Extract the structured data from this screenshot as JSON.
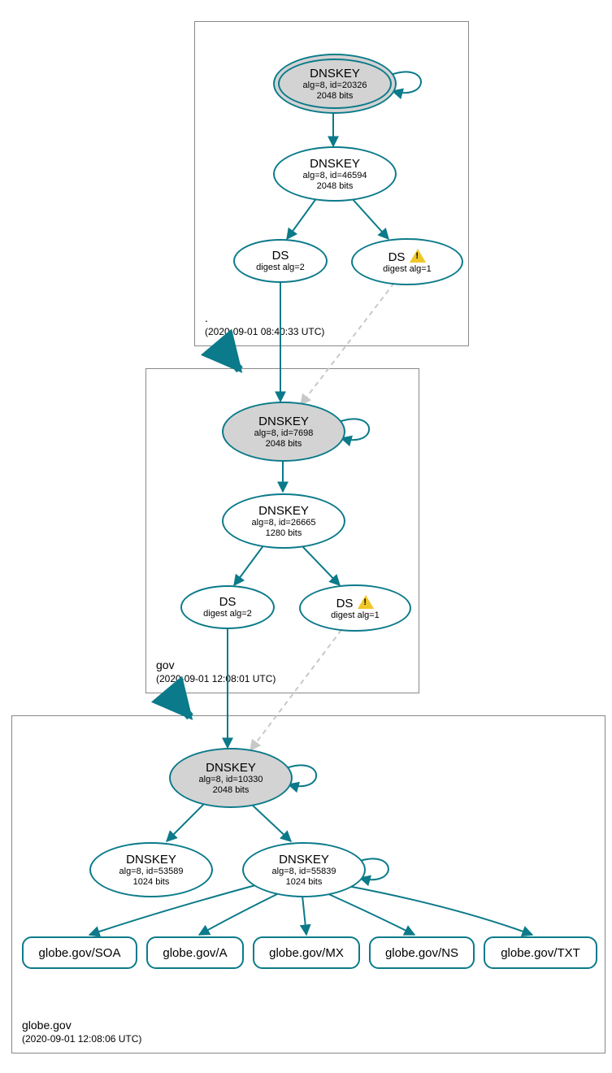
{
  "colors": {
    "stroke": "#0b7a8a",
    "sep_fill": "#d3d3d3",
    "dashed": "#c8c8c8"
  },
  "zones": {
    "root": {
      "title": ".",
      "timestamp": "(2020-09-01 08:40:33 UTC)"
    },
    "gov": {
      "title": "gov",
      "timestamp": "(2020-09-01 12:08:01 UTC)"
    },
    "globe": {
      "title": "globe.gov",
      "timestamp": "(2020-09-01 12:08:06 UTC)"
    }
  },
  "nodes": {
    "root_ksk": {
      "line1": "DNSKEY",
      "line2": "alg=8, id=20326",
      "line3": "2048 bits"
    },
    "root_zsk": {
      "line1": "DNSKEY",
      "line2": "alg=8, id=46594",
      "line3": "2048 bits"
    },
    "root_ds2": {
      "line1": "DS",
      "line2": "digest alg=2"
    },
    "root_ds1": {
      "line1": "DS",
      "line2": "digest alg=1"
    },
    "gov_ksk": {
      "line1": "DNSKEY",
      "line2": "alg=8, id=7698",
      "line3": "2048 bits"
    },
    "gov_zsk": {
      "line1": "DNSKEY",
      "line2": "alg=8, id=26665",
      "line3": "1280 bits"
    },
    "gov_ds2": {
      "line1": "DS",
      "line2": "digest alg=2"
    },
    "gov_ds1": {
      "line1": "DS",
      "line2": "digest alg=1"
    },
    "globe_ksk": {
      "line1": "DNSKEY",
      "line2": "alg=8, id=10330",
      "line3": "2048 bits"
    },
    "globe_zsk1": {
      "line1": "DNSKEY",
      "line2": "alg=8, id=53589",
      "line3": "1024 bits"
    },
    "globe_zsk2": {
      "line1": "DNSKEY",
      "line2": "alg=8, id=55839",
      "line3": "1024 bits"
    }
  },
  "rrsets": {
    "soa": "globe.gov/SOA",
    "a": "globe.gov/A",
    "mx": "globe.gov/MX",
    "ns": "globe.gov/NS",
    "txt": "globe.gov/TXT"
  }
}
